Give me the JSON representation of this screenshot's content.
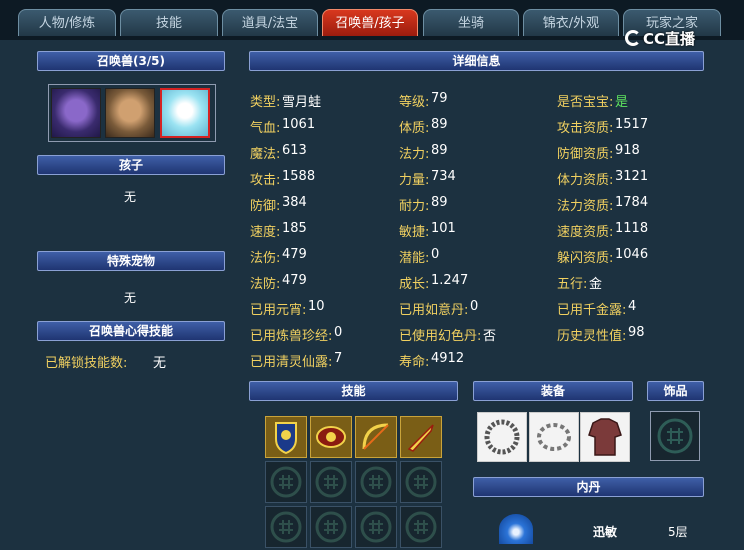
{
  "tabs": [
    {
      "label": "人物/修炼",
      "active": false
    },
    {
      "label": "技能",
      "active": false
    },
    {
      "label": "道具/法宝",
      "active": false
    },
    {
      "label": "召唤兽/孩子",
      "active": true
    },
    {
      "label": "坐骑",
      "active": false
    },
    {
      "label": "锦衣/外观",
      "active": false
    },
    {
      "label": "玩家之家",
      "active": false
    }
  ],
  "watermark": "CC直播",
  "left": {
    "pets_header": "召唤兽(3/5)",
    "pet_icons": [
      "pet-panther-icon",
      "pet-griffin-icon",
      "pet-ice-spirit-icon"
    ],
    "child_header": "孩子",
    "child_value": "无",
    "special_header": "特殊宠物",
    "special_value": "无",
    "skill_header": "召唤兽心得技能",
    "unlocked_label": "已解锁技能数:",
    "unlocked_value": "无"
  },
  "details": {
    "header": "详细信息",
    "rows": [
      [
        {
          "label": "类型:",
          "value": "雪月蛙"
        },
        {
          "label": "等级:",
          "value": "79"
        },
        {
          "label": "是否宝宝:",
          "value": "是",
          "green": true
        }
      ],
      [
        {
          "label": "气血:",
          "value": "1061"
        },
        {
          "label": "体质:",
          "value": "89"
        },
        {
          "label": "攻击资质:",
          "value": "1517"
        }
      ],
      [
        {
          "label": "魔法:",
          "value": "613"
        },
        {
          "label": "法力:",
          "value": "89"
        },
        {
          "label": "防御资质:",
          "value": "918"
        }
      ],
      [
        {
          "label": "攻击:",
          "value": "1588"
        },
        {
          "label": "力量:",
          "value": "734"
        },
        {
          "label": "体力资质:",
          "value": "3121"
        }
      ],
      [
        {
          "label": "防御:",
          "value": "384"
        },
        {
          "label": "耐力:",
          "value": "89"
        },
        {
          "label": "法力资质:",
          "value": "1784"
        }
      ],
      [
        {
          "label": "速度:",
          "value": "185"
        },
        {
          "label": "敏捷:",
          "value": "101"
        },
        {
          "label": "速度资质:",
          "value": "1118"
        }
      ],
      [
        {
          "label": "法伤:",
          "value": "479"
        },
        {
          "label": "潜能:",
          "value": "0"
        },
        {
          "label": "躲闪资质:",
          "value": "1046"
        }
      ],
      [
        {
          "label": "法防:",
          "value": "479"
        },
        {
          "label": "成长:",
          "value": "1.247"
        },
        {
          "label": "五行:",
          "value": "金"
        }
      ],
      [
        {
          "label": "已用元宵:",
          "value": "10"
        },
        {
          "label": "已用如意丹:",
          "value": "0"
        },
        {
          "label": "已用千金露:",
          "value": "4"
        }
      ],
      [
        {
          "label": "已用炼兽珍经:",
          "value": "0"
        },
        {
          "label": "已使用幻色丹:",
          "value": "否"
        },
        {
          "label": "历史灵性值:",
          "value": "98"
        }
      ],
      [
        {
          "label": "已用清灵仙露:",
          "value": "7"
        },
        {
          "label": "寿命:",
          "value": "4912"
        },
        null
      ]
    ]
  },
  "skills": {
    "header": "技能",
    "filled": [
      "skill-shield-icon",
      "skill-eye-icon",
      "skill-bow-icon",
      "skill-sword-icon"
    ]
  },
  "equipment": {
    "header": "装备",
    "items": [
      "necklace-icon",
      "bracelet-icon",
      "armor-icon"
    ]
  },
  "accessory": {
    "header": "饰品"
  },
  "inner_pill": {
    "header": "内丹",
    "name": "迅敏",
    "level": "5层"
  }
}
